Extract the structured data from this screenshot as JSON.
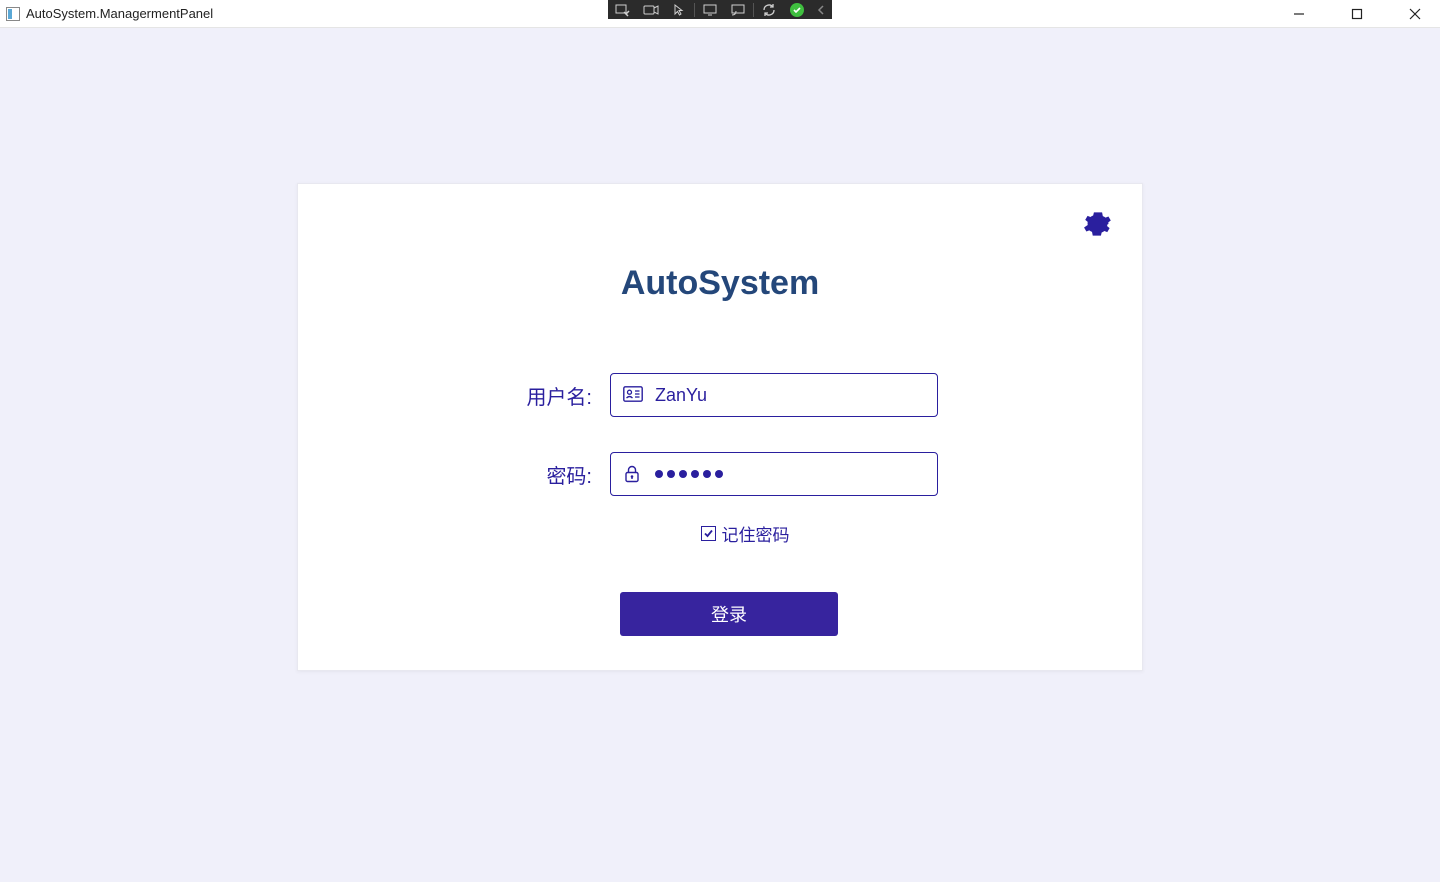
{
  "window": {
    "title": "AutoSystem.ManagermentPanel"
  },
  "login": {
    "app_title": "AutoSystem",
    "username_label": "用户名:",
    "username_value": "ZanYu",
    "password_label": "密码:",
    "password_dots": 6,
    "remember_label": "记住密码",
    "remember_checked": true,
    "login_button": "登录"
  },
  "icons": {
    "settings": "gear-icon",
    "user": "id-card-icon",
    "lock": "lock-icon"
  },
  "colors": {
    "primary": "#2a1f9e",
    "title": "#24477a",
    "button_bg": "#37249e",
    "page_bg": "#f0f0fa"
  }
}
